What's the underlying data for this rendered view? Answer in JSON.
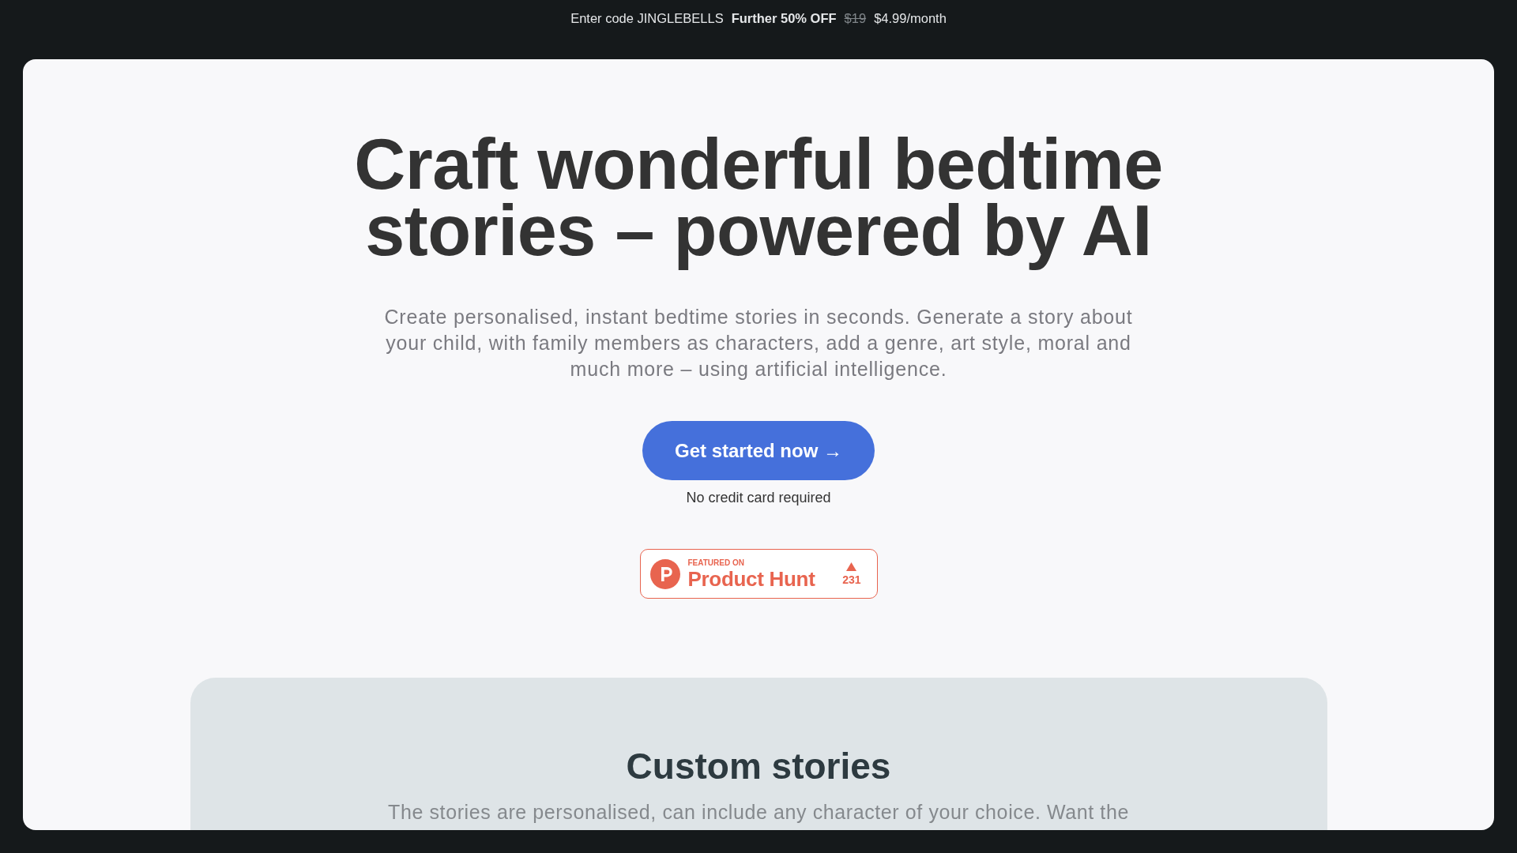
{
  "promo_banner": {
    "code_text": "Enter code JINGLEBELLS",
    "offer": "Further 50% OFF",
    "old_price": "$19",
    "new_price": "$4.99/month"
  },
  "hero": {
    "heading": "Craft wonderful bedtime stories – powered by AI",
    "description": "Create personalised, instant bedtime stories in seconds. Generate a story about your child, with family members as characters, add a genre, art style, moral and much more – using artificial intelligence.",
    "cta_button": "Get started now →",
    "cta_note": "No credit card required"
  },
  "product_hunt_badge": {
    "kicker": "FEATURED ON",
    "name": "Product Hunt",
    "upvotes": "231"
  },
  "feature_section": {
    "title": "Custom stories",
    "description": "The stories are personalised, can include any character of your choice. Want the"
  }
}
